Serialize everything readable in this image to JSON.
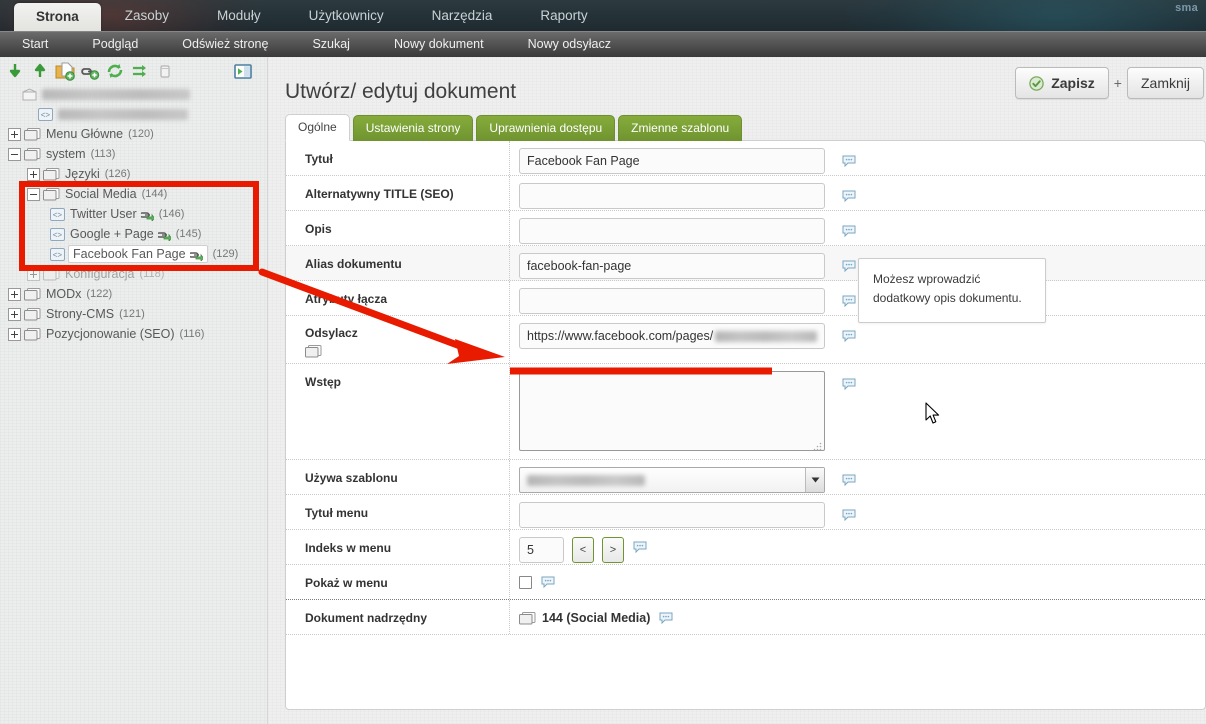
{
  "topnav": {
    "items": [
      {
        "label": "Strona",
        "active": true
      },
      {
        "label": "Zasoby",
        "active": false
      },
      {
        "label": "Moduły",
        "active": false
      },
      {
        "label": "Użytkownicy",
        "active": false
      },
      {
        "label": "Narzędzia",
        "active": false
      },
      {
        "label": "Raporty",
        "active": false
      }
    ],
    "brand": "sma"
  },
  "subnav": {
    "items": [
      {
        "label": "Start"
      },
      {
        "label": "Podgląd"
      },
      {
        "label": "Odśwież stronę"
      },
      {
        "label": "Szukaj"
      },
      {
        "label": "Nowy dokument"
      },
      {
        "label": "Nowy odsyłacz"
      }
    ]
  },
  "tree_toolbar": {
    "icons": [
      {
        "name": "collapse-all-icon",
        "title": "Zwiń wszystko"
      },
      {
        "name": "expand-all-icon",
        "title": "Rozwiń wszystko"
      },
      {
        "name": "new-document-icon",
        "title": "Nowy dokument"
      },
      {
        "name": "new-weblink-icon",
        "title": "Nowy odsyłacz"
      },
      {
        "name": "refresh-tree-icon",
        "title": "Odśwież"
      },
      {
        "name": "sort-tree-icon",
        "title": "Sortuj"
      },
      {
        "name": "trash-icon",
        "title": "Kosz"
      },
      {
        "name": "toggle-panel-icon",
        "title": "Ukryj panel"
      }
    ]
  },
  "tree": {
    "root": {
      "label": "",
      "redacted": true,
      "redacted_width": 148
    },
    "nodes": [
      {
        "id": "home",
        "label": "",
        "redacted": true,
        "redacted_width": 130,
        "type": "weblink",
        "indent": 1,
        "toggle": "none",
        "count": ""
      },
      {
        "id": "menu-glowne",
        "label": "Menu Główne",
        "count": "(120)",
        "type": "folder",
        "indent": 0,
        "toggle": "plus"
      },
      {
        "id": "system",
        "label": "system",
        "count": "(113)",
        "type": "folder",
        "indent": 0,
        "toggle": "minus"
      },
      {
        "id": "jezyki",
        "label": "Języki",
        "count": "(126)",
        "type": "folder",
        "indent": 1,
        "toggle": "plus"
      },
      {
        "id": "social-media",
        "label": "Social Media",
        "count": "(144)",
        "type": "folder",
        "indent": 1,
        "toggle": "minus"
      },
      {
        "id": "twitter-user",
        "label": "Twitter User",
        "count": "(146)",
        "type": "weblink",
        "indent": 2,
        "toggle": "none"
      },
      {
        "id": "google-plus-page",
        "label": "Google + Page",
        "count": "(145)",
        "type": "weblink",
        "indent": 2,
        "toggle": "none"
      },
      {
        "id": "facebook-fan-page",
        "label": "Facebook Fan Page",
        "count": "(129)",
        "type": "weblink",
        "indent": 2,
        "toggle": "none",
        "selected": true
      },
      {
        "id": "konfiguracja",
        "label": "Konfiguracja",
        "count": "(118)",
        "type": "folder",
        "indent": 1,
        "toggle": "plus",
        "dimmed": true
      },
      {
        "id": "modx",
        "label": "MODx",
        "count": "(122)",
        "type": "folder",
        "indent": 0,
        "toggle": "plus"
      },
      {
        "id": "strony-cms",
        "label": "Strony-CMS",
        "count": "(121)",
        "type": "folder",
        "indent": 0,
        "toggle": "plus"
      },
      {
        "id": "pozycjonowanie-seo",
        "label": "Pozycjonowanie (SEO)",
        "count": "(116)",
        "type": "folder",
        "indent": 0,
        "toggle": "plus"
      }
    ]
  },
  "main": {
    "title": "Utwórz/ edytuj dokument",
    "save_label": "Zapisz",
    "plus_label": "+",
    "close_label": "Zamknij",
    "tabs": [
      {
        "label": "Ogólne",
        "active": true
      },
      {
        "label": "Ustawienia strony",
        "active": false
      },
      {
        "label": "Uprawnienia dostępu",
        "active": false
      },
      {
        "label": "Zmienne szablonu",
        "active": false
      }
    ]
  },
  "form": {
    "rows": [
      {
        "label": "Tytuł",
        "value": "Facebook Fan Page",
        "type": "text"
      },
      {
        "label": "Alternatywny TITLE (SEO)",
        "value": "",
        "type": "text"
      },
      {
        "label": "Opis",
        "value": "",
        "type": "text"
      },
      {
        "label": "Alias dokumentu",
        "value": "facebook-fan-page",
        "type": "text"
      },
      {
        "label": "Atrybuty łącza",
        "value": "",
        "type": "text"
      },
      {
        "label": "Odsylacz",
        "value": "https://www.facebook.com/pages/",
        "value_redacted": true,
        "type": "text"
      },
      {
        "label": "Wstęp",
        "value": "",
        "type": "textarea"
      },
      {
        "label": "Używa szablonu",
        "value": "",
        "value_redacted": true,
        "type": "select"
      },
      {
        "label": "Tytuł menu",
        "value": "",
        "type": "text"
      },
      {
        "label": "Indeks w menu",
        "value": "5",
        "type": "number"
      },
      {
        "label": "Pokaż w menu",
        "value": "",
        "type": "checkbox"
      },
      {
        "label": "Dokument nadrzędny",
        "value": "144 (Social Media)",
        "type": "parent"
      }
    ],
    "nav_prev_label": "<",
    "nav_next_label": ">"
  },
  "tooltip": {
    "line1": "Możesz wprowadzić",
    "line2": "dodatkowy opis dokumentu."
  },
  "colors": {
    "tab_green": "#7d9f37",
    "annotation_red": "#e81b00",
    "nav_dark": "#26343a",
    "subnav_gray": "#5a5a5a"
  }
}
